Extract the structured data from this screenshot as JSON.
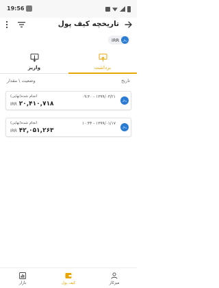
{
  "status_bar": {
    "time": "19:56"
  },
  "header": {
    "title": "تاریخچه کیف پول",
    "back_icon": "arrow-right-icon",
    "filter_icon": "filter-icon",
    "more_icon": "more-vertical-icon"
  },
  "currency_chip": {
    "label": "IRR",
    "badge": "ریال"
  },
  "tabs": [
    {
      "label": "برداشت",
      "icon": "wallet-out-icon",
      "active": true
    },
    {
      "label": "واریز",
      "icon": "wallet-in-icon",
      "active": false
    }
  ],
  "columns": {
    "date": "تاریخ",
    "status_amount": "وضعیت \\ مقدار"
  },
  "transactions": [
    {
      "badge": "ریال",
      "date": "۱۳۹۹/۰۳/۲۱ - ۰۹:۳۰",
      "status": "انجام شده(نهایی)",
      "currency": "IRR",
      "amount": "۲۰,۴۱۰,۷۱۸"
    },
    {
      "badge": "ریال",
      "date": "۱۳۹۹/۰۱/۱۷ - ۱۰:۴۴",
      "status": "انجام شده(نهایی)",
      "currency": "IRR",
      "amount": "۴۲,۰۵۱,۲۶۳"
    }
  ],
  "bottom_nav": [
    {
      "label": "بازار",
      "icon": "chart-icon"
    },
    {
      "label": "کیف پول",
      "icon": "wallet-icon",
      "active": true
    },
    {
      "label": "میزکار",
      "icon": "user-icon"
    }
  ],
  "colors": {
    "accent": "#e8a600",
    "rial_badge": "#2a7bd2"
  }
}
